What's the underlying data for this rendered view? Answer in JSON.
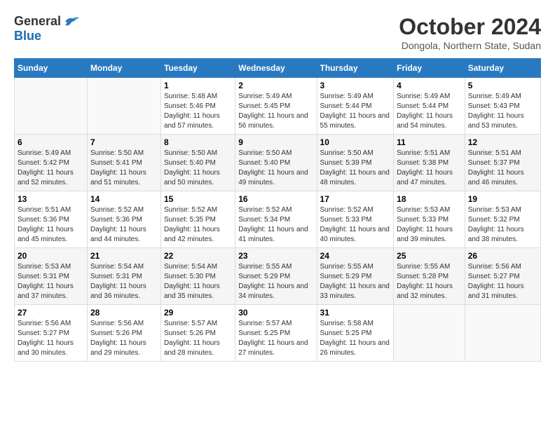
{
  "logo": {
    "general": "General",
    "blue": "Blue"
  },
  "title": "October 2024",
  "location": "Dongola, Northern State, Sudan",
  "days_header": [
    "Sunday",
    "Monday",
    "Tuesday",
    "Wednesday",
    "Thursday",
    "Friday",
    "Saturday"
  ],
  "weeks": [
    [
      {
        "day": "",
        "sunrise": "",
        "sunset": "",
        "daylight": ""
      },
      {
        "day": "",
        "sunrise": "",
        "sunset": "",
        "daylight": ""
      },
      {
        "day": "1",
        "sunrise": "Sunrise: 5:48 AM",
        "sunset": "Sunset: 5:46 PM",
        "daylight": "Daylight: 11 hours and 57 minutes."
      },
      {
        "day": "2",
        "sunrise": "Sunrise: 5:49 AM",
        "sunset": "Sunset: 5:45 PM",
        "daylight": "Daylight: 11 hours and 56 minutes."
      },
      {
        "day": "3",
        "sunrise": "Sunrise: 5:49 AM",
        "sunset": "Sunset: 5:44 PM",
        "daylight": "Daylight: 11 hours and 55 minutes."
      },
      {
        "day": "4",
        "sunrise": "Sunrise: 5:49 AM",
        "sunset": "Sunset: 5:44 PM",
        "daylight": "Daylight: 11 hours and 54 minutes."
      },
      {
        "day": "5",
        "sunrise": "Sunrise: 5:49 AM",
        "sunset": "Sunset: 5:43 PM",
        "daylight": "Daylight: 11 hours and 53 minutes."
      }
    ],
    [
      {
        "day": "6",
        "sunrise": "Sunrise: 5:49 AM",
        "sunset": "Sunset: 5:42 PM",
        "daylight": "Daylight: 11 hours and 52 minutes."
      },
      {
        "day": "7",
        "sunrise": "Sunrise: 5:50 AM",
        "sunset": "Sunset: 5:41 PM",
        "daylight": "Daylight: 11 hours and 51 minutes."
      },
      {
        "day": "8",
        "sunrise": "Sunrise: 5:50 AM",
        "sunset": "Sunset: 5:40 PM",
        "daylight": "Daylight: 11 hours and 50 minutes."
      },
      {
        "day": "9",
        "sunrise": "Sunrise: 5:50 AM",
        "sunset": "Sunset: 5:40 PM",
        "daylight": "Daylight: 11 hours and 49 minutes."
      },
      {
        "day": "10",
        "sunrise": "Sunrise: 5:50 AM",
        "sunset": "Sunset: 5:39 PM",
        "daylight": "Daylight: 11 hours and 48 minutes."
      },
      {
        "day": "11",
        "sunrise": "Sunrise: 5:51 AM",
        "sunset": "Sunset: 5:38 PM",
        "daylight": "Daylight: 11 hours and 47 minutes."
      },
      {
        "day": "12",
        "sunrise": "Sunrise: 5:51 AM",
        "sunset": "Sunset: 5:37 PM",
        "daylight": "Daylight: 11 hours and 46 minutes."
      }
    ],
    [
      {
        "day": "13",
        "sunrise": "Sunrise: 5:51 AM",
        "sunset": "Sunset: 5:36 PM",
        "daylight": "Daylight: 11 hours and 45 minutes."
      },
      {
        "day": "14",
        "sunrise": "Sunrise: 5:52 AM",
        "sunset": "Sunset: 5:36 PM",
        "daylight": "Daylight: 11 hours and 44 minutes."
      },
      {
        "day": "15",
        "sunrise": "Sunrise: 5:52 AM",
        "sunset": "Sunset: 5:35 PM",
        "daylight": "Daylight: 11 hours and 42 minutes."
      },
      {
        "day": "16",
        "sunrise": "Sunrise: 5:52 AM",
        "sunset": "Sunset: 5:34 PM",
        "daylight": "Daylight: 11 hours and 41 minutes."
      },
      {
        "day": "17",
        "sunrise": "Sunrise: 5:52 AM",
        "sunset": "Sunset: 5:33 PM",
        "daylight": "Daylight: 11 hours and 40 minutes."
      },
      {
        "day": "18",
        "sunrise": "Sunrise: 5:53 AM",
        "sunset": "Sunset: 5:33 PM",
        "daylight": "Daylight: 11 hours and 39 minutes."
      },
      {
        "day": "19",
        "sunrise": "Sunrise: 5:53 AM",
        "sunset": "Sunset: 5:32 PM",
        "daylight": "Daylight: 11 hours and 38 minutes."
      }
    ],
    [
      {
        "day": "20",
        "sunrise": "Sunrise: 5:53 AM",
        "sunset": "Sunset: 5:31 PM",
        "daylight": "Daylight: 11 hours and 37 minutes."
      },
      {
        "day": "21",
        "sunrise": "Sunrise: 5:54 AM",
        "sunset": "Sunset: 5:31 PM",
        "daylight": "Daylight: 11 hours and 36 minutes."
      },
      {
        "day": "22",
        "sunrise": "Sunrise: 5:54 AM",
        "sunset": "Sunset: 5:30 PM",
        "daylight": "Daylight: 11 hours and 35 minutes."
      },
      {
        "day": "23",
        "sunrise": "Sunrise: 5:55 AM",
        "sunset": "Sunset: 5:29 PM",
        "daylight": "Daylight: 11 hours and 34 minutes."
      },
      {
        "day": "24",
        "sunrise": "Sunrise: 5:55 AM",
        "sunset": "Sunset: 5:29 PM",
        "daylight": "Daylight: 11 hours and 33 minutes."
      },
      {
        "day": "25",
        "sunrise": "Sunrise: 5:55 AM",
        "sunset": "Sunset: 5:28 PM",
        "daylight": "Daylight: 11 hours and 32 minutes."
      },
      {
        "day": "26",
        "sunrise": "Sunrise: 5:56 AM",
        "sunset": "Sunset: 5:27 PM",
        "daylight": "Daylight: 11 hours and 31 minutes."
      }
    ],
    [
      {
        "day": "27",
        "sunrise": "Sunrise: 5:56 AM",
        "sunset": "Sunset: 5:27 PM",
        "daylight": "Daylight: 11 hours and 30 minutes."
      },
      {
        "day": "28",
        "sunrise": "Sunrise: 5:56 AM",
        "sunset": "Sunset: 5:26 PM",
        "daylight": "Daylight: 11 hours and 29 minutes."
      },
      {
        "day": "29",
        "sunrise": "Sunrise: 5:57 AM",
        "sunset": "Sunset: 5:26 PM",
        "daylight": "Daylight: 11 hours and 28 minutes."
      },
      {
        "day": "30",
        "sunrise": "Sunrise: 5:57 AM",
        "sunset": "Sunset: 5:25 PM",
        "daylight": "Daylight: 11 hours and 27 minutes."
      },
      {
        "day": "31",
        "sunrise": "Sunrise: 5:58 AM",
        "sunset": "Sunset: 5:25 PM",
        "daylight": "Daylight: 11 hours and 26 minutes."
      },
      {
        "day": "",
        "sunrise": "",
        "sunset": "",
        "daylight": ""
      },
      {
        "day": "",
        "sunrise": "",
        "sunset": "",
        "daylight": ""
      }
    ]
  ]
}
